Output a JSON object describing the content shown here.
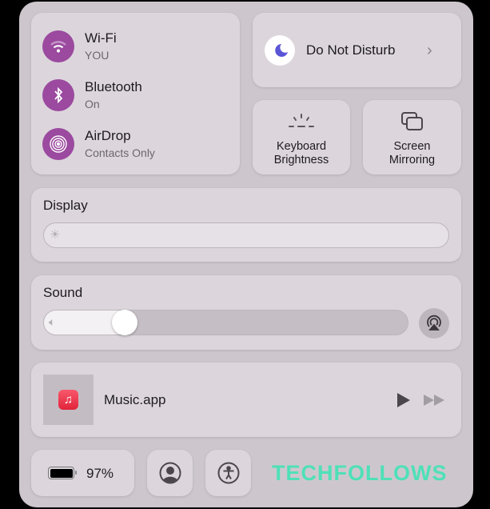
{
  "connectivity": [
    {
      "name": "Wi-Fi",
      "status": "YOU",
      "icon": "wifi-icon"
    },
    {
      "name": "Bluetooth",
      "status": "On",
      "icon": "bluetooth-icon"
    },
    {
      "name": "AirDrop",
      "status": "Contacts Only",
      "icon": "airdrop-icon"
    }
  ],
  "dnd": {
    "label": "Do Not Disturb",
    "icon": "moon-icon"
  },
  "keyboard": {
    "line1": "Keyboard",
    "line2": "Brightness"
  },
  "mirroring": {
    "line1": "Screen",
    "line2": "Mirroring"
  },
  "display": {
    "title": "Display",
    "brightness_percent": 0
  },
  "sound": {
    "title": "Sound",
    "volume_percent": 20
  },
  "now_playing": {
    "app": "Music.app"
  },
  "battery": {
    "percent": "97%"
  },
  "watermark": "TECHFOLLOWS",
  "colors": {
    "accent": "#9b4a9f",
    "watermark": "#4fe0b8",
    "dnd": "#5a55d6"
  }
}
